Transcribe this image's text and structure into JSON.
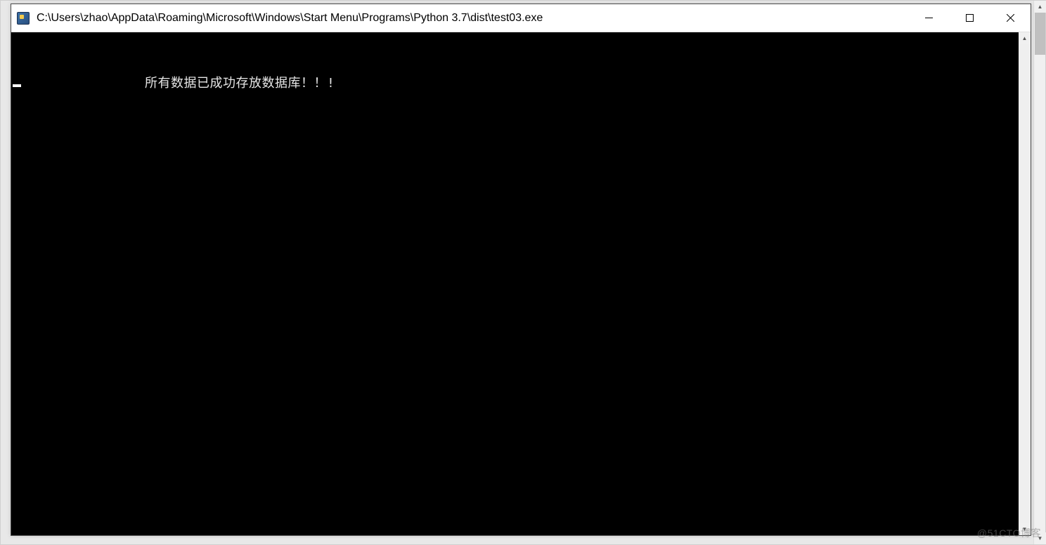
{
  "titlebar": {
    "path": "C:\\Users\\zhao\\AppData\\Roaming\\Microsoft\\Windows\\Start Menu\\Programs\\Python 3.7\\dist\\test03.exe"
  },
  "console": {
    "output_line1": "所有数据已成功存放数据库！！!"
  },
  "watermark": {
    "text": "@51CTO博客"
  }
}
